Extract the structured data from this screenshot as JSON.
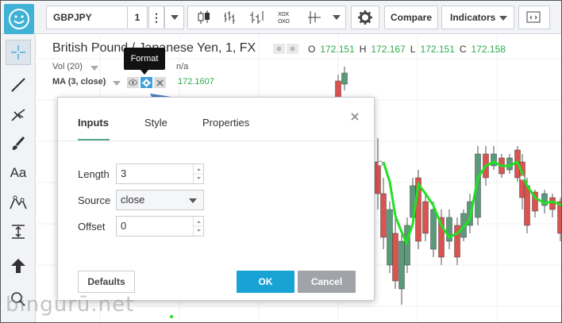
{
  "toolbar": {
    "symbol": "GBPJPY",
    "interval": "1",
    "compare_label": "Compare",
    "indicators_label": "Indicators"
  },
  "legend": {
    "title": "British Pound / Japanese Yen, 1, FX",
    "ohlc": [
      {
        "key": "O",
        "value": "172.151"
      },
      {
        "key": "H",
        "value": "172.167"
      },
      {
        "key": "L",
        "value": "172.151"
      },
      {
        "key": "C",
        "value": "172.158"
      }
    ],
    "vol_label": "Vol (20)",
    "vol_value": "n/a",
    "ma_label": "MA (3, close)",
    "ma_value": "172.1607"
  },
  "tooltip": {
    "text": "Format"
  },
  "dialog": {
    "tabs": [
      "Inputs",
      "Style",
      "Properties"
    ],
    "active_tab": "Inputs",
    "fields": [
      {
        "label": "Length",
        "value": "3",
        "type": "number"
      },
      {
        "label": "Source",
        "value": "close",
        "type": "select"
      },
      {
        "label": "Offset",
        "value": "0",
        "type": "number"
      }
    ],
    "defaults_label": "Defaults",
    "ok_label": "OK",
    "cancel_label": "Cancel"
  },
  "watermark": "bingurū.net",
  "colors": {
    "accent": "#3fb2d6",
    "up_candle": "#5a9a7a",
    "down_candle": "#d9534f",
    "ma_line": "#22e022",
    "price_green": "#2bab4c",
    "arrow": "#4a7ac9",
    "ok_button": "#19a3d4",
    "cancel_button": "#a0a4a8"
  }
}
